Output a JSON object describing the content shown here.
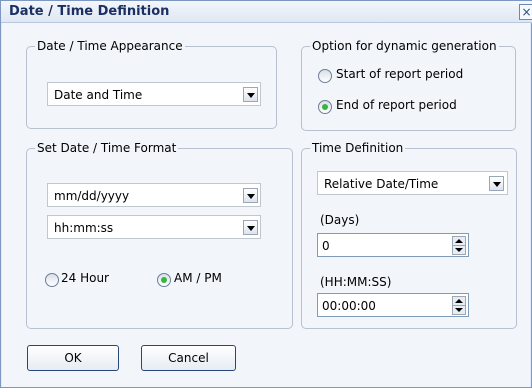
{
  "window": {
    "title": "Date / Time Definition",
    "close_symbol": "×"
  },
  "appearance": {
    "group_title": "Date / Time Appearance",
    "selected_value": "Date and Time"
  },
  "dynamic_generation": {
    "group_title": "Option for dynamic generation",
    "options": [
      {
        "label": "Start of report period",
        "selected": false
      },
      {
        "label": "End of report period",
        "selected": true
      }
    ]
  },
  "format": {
    "group_title": "Set Date / Time Format",
    "date_format": "mm/dd/yyyy",
    "time_format": "hh:mm:ss",
    "clock_options": [
      {
        "label": "24 Hour",
        "selected": false
      },
      {
        "label": "AM / PM",
        "selected": true
      }
    ]
  },
  "time_definition": {
    "group_title": "Time Definition",
    "mode": "Relative Date/Time",
    "days_label": "(Days)",
    "days_value": "0",
    "time_label": "(HH:MM:SS)",
    "time_value": "00:00:00"
  },
  "buttons": {
    "ok": "OK",
    "cancel": "Cancel"
  },
  "colors": {
    "titlebar_text": "#1b2f63",
    "selected_radio": "#35b63d",
    "window_border": "#7c98c2"
  },
  "icons": {
    "close": "close-icon",
    "dropdown": "chevron-down-icon",
    "spin": "spinner-icon"
  }
}
